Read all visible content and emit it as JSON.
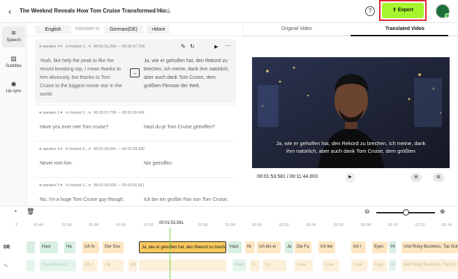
{
  "header": {
    "back_icon": "chevron-left-icon",
    "title": "The Weeknd Reveals How Tom Cruise Transformed His...",
    "saved_label": "Saved",
    "help_label": "?",
    "export_label": "Export",
    "accent": "#a6f42d",
    "highlight_border": "#e0242b"
  },
  "sidebar": {
    "items": [
      {
        "label": "Speech",
        "icon": "waveform-icon"
      },
      {
        "label": "Subtitles",
        "icon": "subtitles-icon"
      },
      {
        "label": "Lip-sync",
        "icon": "lips-icon"
      }
    ]
  },
  "languages": {
    "source": "English",
    "translate_to_label": "translate to",
    "target": "German(DE)",
    "more_label": "+More"
  },
  "segments": [
    {
      "speaker": "speaker 3",
      "mode": "Instant V...",
      "start": "00:01:51.250",
      "dash": "—",
      "end": "00:01:57.728",
      "source": "Yeah, like help the peak to like the record breaking top, I mean thanks to him obviously, but thanks to Tom Cruise to the biggest movie star in the world.",
      "target": "Ja, wie er geholfen hat, den Rekord zu brechen, ich meine, dank ihm natürlich, aber auch dank Tom Cruise, dem größten Filmstar der Welt."
    },
    {
      "speaker": "speaker 1",
      "mode": "Instant V...",
      "start": "00:01:57.730",
      "dash": "—",
      "end": "00:01:59.041",
      "source": "Have you ever met Tom cruise?",
      "target": "Hast du je Tom Cruise getroffen?"
    },
    {
      "speaker": "speaker 3",
      "mode": "Instant V...",
      "start": "00:01:59.041",
      "dash": "—",
      "end": "00:01:59.930",
      "source": "Never met him.",
      "target": "Nie getroffen."
    },
    {
      "speaker": "speaker 3",
      "mode": "Instant V...",
      "start": "00:01:59.930",
      "dash": "—",
      "end": "00:02:01.811",
      "source": "No, I'm a huge Tom Cruise guy though.",
      "target": "Ich bin ein großer Fan von Tom Cruise."
    }
  ],
  "video_tabs": {
    "original": "Original Video",
    "translated": "Translated Video"
  },
  "video": {
    "subtitle_line1": "Ja, wie er geholfen hat, den Rekord zu brechen, ich meine, dank",
    "subtitle_line2": "ihm natürlich, aber auch dank Tom Cruise, dem größten",
    "time": "00:01:53.581 / 00:11:44.003"
  },
  "timeline": {
    "ticks": [
      "2",
      "01:44",
      "01:46",
      "01:48",
      "01:50",
      "01:52",
      "01:54",
      "01:56",
      "01:58",
      "02:00",
      "02:02",
      "02:04",
      "02:06",
      "02:08",
      "02:10",
      "02:12",
      "02:14"
    ],
    "playhead_time": "00:01:53.581",
    "track_label": "DE",
    "de_clips": [
      "",
      "Hast",
      "Ha",
      "Ich fo",
      "Der Sou",
      "Ja, wie er geholfen hat, den Rekord zu brechen",
      "Hast",
      "Ni",
      "Ich bin ei",
      "Ja",
      "Die Fa",
      "Ich liet",
      "Ich l",
      "Eyes",
      "Hi",
      "Und Risky Business, Top Gun"
    ],
    "orig_clips": [
      "",
      "You did you d",
      "Oh, I",
      "I fe",
      "Ich fu",
      "",
      "Have",
      "N",
      "I'm ",
      "Love",
      "Love",
      "Love",
      "Eyes",
      "Hi",
      "And Risky Business, Top Gu"
    ]
  }
}
